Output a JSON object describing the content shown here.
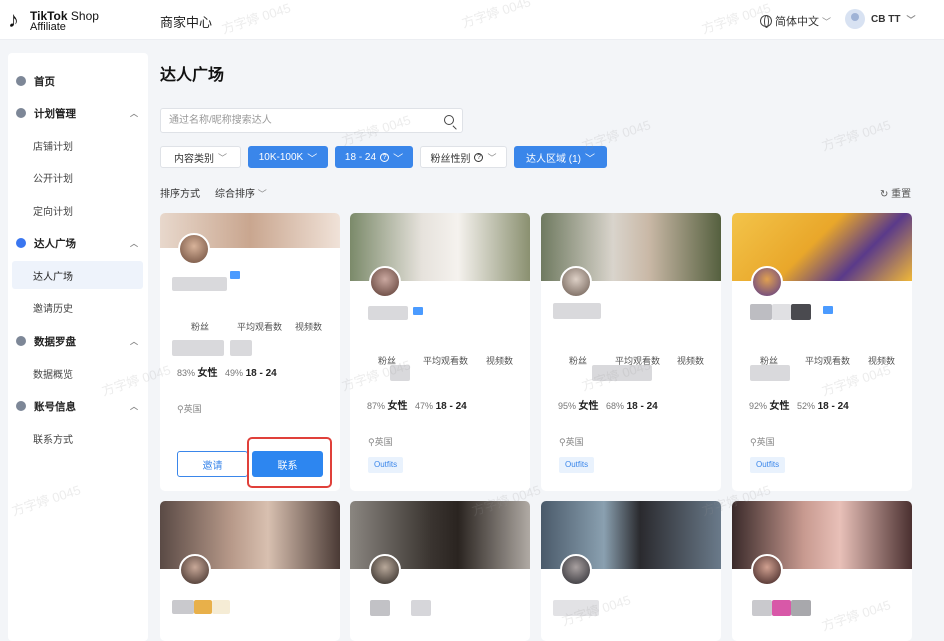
{
  "header": {
    "brand_line1": "TikTok",
    "brand_line1_suffix": "Shop",
    "brand_line2": "Affiliate",
    "center_title": "商家中心",
    "language": "简体中文",
    "user": "CB TT"
  },
  "sidebar": {
    "home": "首页",
    "plan_mgmt": "计划管理",
    "shop_plan": "店铺计划",
    "public_plan": "公开计划",
    "targeted_plan": "定向计划",
    "creator_square": "达人广场",
    "creator_square_sub": "达人广场",
    "invite_history": "邀请历史",
    "data_compass": "数据罗盘",
    "data_overview": "数据概览",
    "account_info": "账号信息",
    "contact": "联系方式"
  },
  "main": {
    "title": "达人广场",
    "search_placeholder": "通过名称/昵称搜索达人",
    "filters": {
      "content_category": "内容类别",
      "followers": "10K-100K",
      "age": "18 - 24",
      "fan_gender": "粉丝性别",
      "creator_region": "达人区域 (1)"
    },
    "sort_label": "排序方式",
    "sort_value": "综合排序",
    "reset": "重置"
  },
  "card_labels": {
    "followers": "粉丝",
    "avg_views": "平均观看数",
    "videos": "视频数",
    "female": "女性",
    "age_range": "18 - 24",
    "location": "英国",
    "tag": "Outfits",
    "invite": "邀请",
    "contact": "联系"
  },
  "cards": [
    {
      "female_pct": "83%",
      "age_pct": "49%"
    },
    {
      "female_pct": "87%",
      "age_pct": "47%"
    },
    {
      "female_pct": "95%",
      "age_pct": "68%"
    },
    {
      "female_pct": "92%",
      "age_pct": "52%"
    }
  ],
  "watermark": "方字婷 0045",
  "colors": {
    "accent": "#3a86ea",
    "highlight": "#e0403a"
  }
}
